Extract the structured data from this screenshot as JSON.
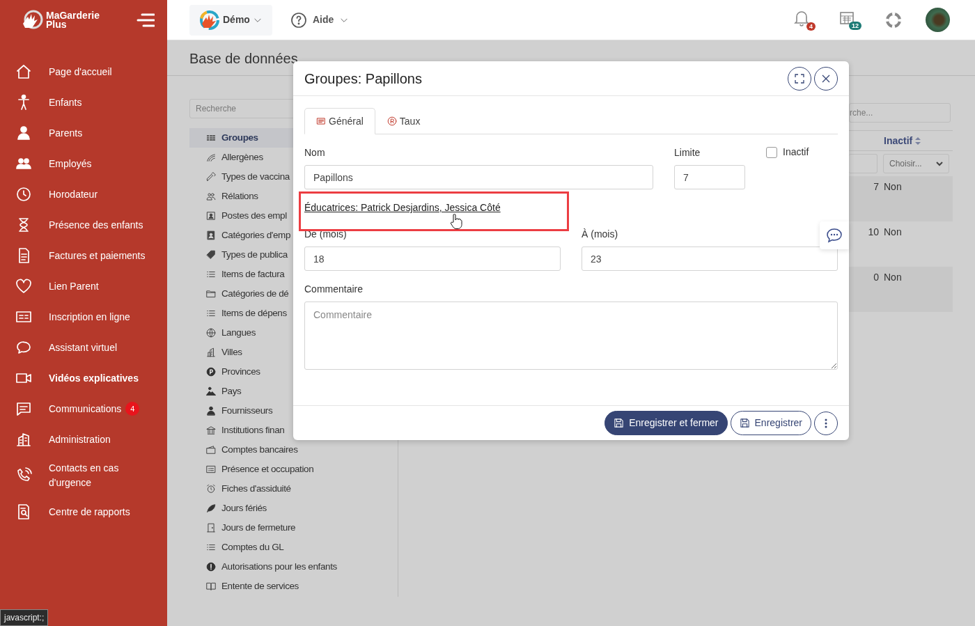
{
  "sidebar": {
    "logo_lines": [
      "MaGarderie",
      "Plus"
    ],
    "items": [
      {
        "label": "Page d'accueil",
        "highlighted": false
      },
      {
        "label": "Enfants",
        "highlighted": false
      },
      {
        "label": "Parents",
        "highlighted": false
      },
      {
        "label": "Employés",
        "highlighted": false
      },
      {
        "label": "Horodateur",
        "highlighted": false
      },
      {
        "label": "Présence des enfants",
        "highlighted": false
      },
      {
        "label": "Factures et paiements",
        "highlighted": false
      },
      {
        "label": "Lien Parent",
        "highlighted": false
      },
      {
        "label": "Inscription en ligne",
        "highlighted": false
      },
      {
        "label": "Assistant virtuel",
        "highlighted": false
      },
      {
        "label": "Vidéos explicatives",
        "highlighted": true
      },
      {
        "label": "Communications",
        "highlighted": false,
        "badge": "4"
      },
      {
        "label": "Administration",
        "highlighted": false
      },
      {
        "label": "Contacts en cas d'urgence",
        "highlighted": false
      },
      {
        "label": "Centre de rapports",
        "highlighted": false
      }
    ]
  },
  "top_bar": {
    "account": "Démo",
    "help": "Aide",
    "notifications_badge": "4",
    "calendar_badge": "12"
  },
  "page_title": "Base de données",
  "database_list": {
    "search_placeholder": "Recherche",
    "items": [
      {
        "label": "Groupes",
        "selected": true
      },
      {
        "label": "Allergènes",
        "selected": false
      },
      {
        "label": "Types de vaccina",
        "selected": false
      },
      {
        "label": "Rélations",
        "selected": false
      },
      {
        "label": "Postes des empl",
        "selected": false
      },
      {
        "label": "Catégories d'emp",
        "selected": false
      },
      {
        "label": "Types de publica",
        "selected": false
      },
      {
        "label": "Items de factura",
        "selected": false
      },
      {
        "label": "Catégories de dé",
        "selected": false
      },
      {
        "label": "Items de dépens",
        "selected": false
      },
      {
        "label": "Langues",
        "selected": false
      },
      {
        "label": "Villes",
        "selected": false
      },
      {
        "label": "Provinces",
        "selected": false
      },
      {
        "label": "Pays",
        "selected": false
      },
      {
        "label": "Fournisseurs",
        "selected": false
      },
      {
        "label": "Institutions finan",
        "selected": false
      },
      {
        "label": "Comptes bancaires",
        "selected": false
      },
      {
        "label": "Présence et occupation",
        "selected": false
      },
      {
        "label": "Fiches d'assiduité",
        "selected": false
      },
      {
        "label": "Jours fériés",
        "selected": false
      },
      {
        "label": "Jours de fermeture",
        "selected": false
      },
      {
        "label": "Comptes du GL",
        "selected": false
      },
      {
        "label": "Autorisations pour les enfants",
        "selected": false
      },
      {
        "label": "Entente de services",
        "selected": false
      }
    ]
  },
  "table": {
    "search_placeholder": "rche...",
    "column_header": "Inactif",
    "filter_placeholder": "Choisir...",
    "rows": [
      {
        "column_1": "7",
        "inactif": "Non"
      },
      {
        "column_1": "10",
        "inactif": "Non"
      },
      {
        "column_1": "0",
        "inactif": "Non"
      }
    ]
  },
  "modal": {
    "title": "Groupes: Papillons",
    "tabs": [
      {
        "label": "Général",
        "selected": true
      },
      {
        "label": "Taux",
        "selected": false
      }
    ],
    "name": {
      "label": "Nom",
      "value": "Papillons"
    },
    "limit": {
      "label": "Limite",
      "value": "7"
    },
    "inactive": {
      "label": "Inactif",
      "checked": false
    },
    "educators_link": "Éducatrices: Patrick Desjardins, Jessica Côté",
    "from": {
      "label": "De (mois)",
      "value": "18"
    },
    "to": {
      "label": "À (mois)",
      "value": "23"
    },
    "comment": {
      "label": "Commentaire",
      "placeholder": "Commentaire"
    },
    "buttons": [
      {
        "label": "Enregistrer et fermer",
        "kind": "primary"
      },
      {
        "label": "Enregistrer",
        "kind": "outline"
      }
    ]
  },
  "status_text": "javascript:;"
}
